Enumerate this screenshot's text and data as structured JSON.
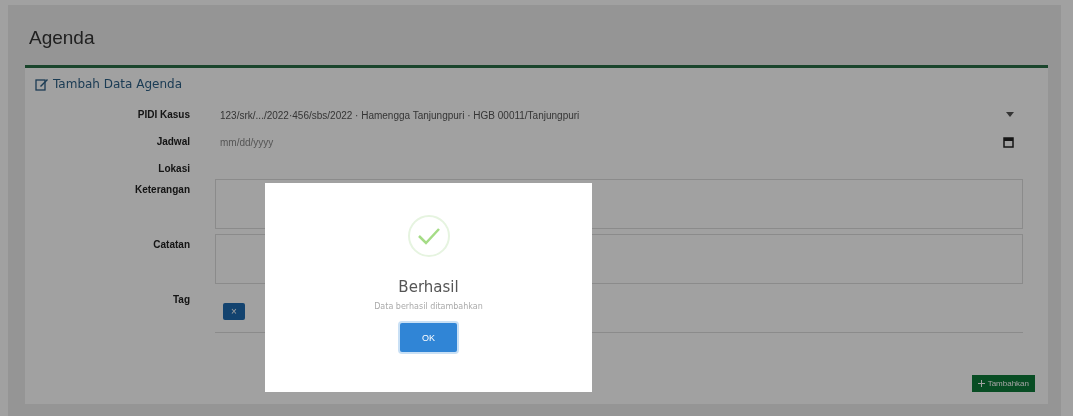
{
  "page_title": "Agenda",
  "card": {
    "title": "Tambah Data Agenda"
  },
  "fields": [
    {
      "kind": "select",
      "label": "PIDI Kasus",
      "value": "123/srk/.../2022·456/sbs/2022 · Hamengga Tanjungpuri · HGB 00011/Tanjungpuri"
    },
    {
      "kind": "date",
      "label": "Jadwal",
      "placeholder": "mm/dd/yyyy"
    },
    {
      "kind": "text",
      "label": "Lokasi"
    },
    {
      "kind": "textarea",
      "label": "Keterangan"
    },
    {
      "kind": "textarea",
      "label": "Catatan"
    },
    {
      "kind": "tags",
      "label": "Tag",
      "tags": [
        "×"
      ]
    }
  ],
  "submit": "Tambahkan",
  "dialog": {
    "title": "Berhasil",
    "message": "Data berhasil ditambahkan",
    "button": "OK"
  }
}
